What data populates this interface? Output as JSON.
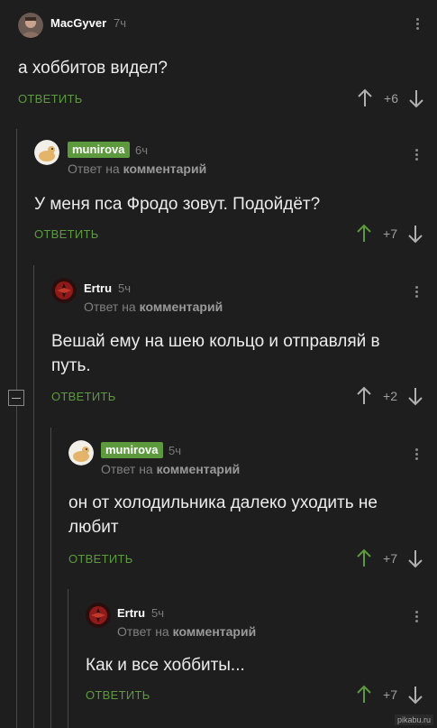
{
  "comments": [
    {
      "author": "MacGyver",
      "time": "7ч",
      "reply_to_prefix": "",
      "reply_to_target": "",
      "text": "а хоббитов видел?",
      "reply_label": "ОТВЕТИТЬ",
      "rating": "+6",
      "avatar_icon": "man-portrait-avatar"
    },
    {
      "author": "munirova",
      "time": "6ч",
      "reply_to_prefix": "Ответ на",
      "reply_to_target": "комментарий",
      "text": "У меня пса Фродо зовут. Подойдёт?",
      "reply_label": "ОТВЕТИТЬ",
      "rating": "+7",
      "avatar_icon": "dog-avatar"
    },
    {
      "author": "Ertru",
      "time": "5ч",
      "reply_to_prefix": "Ответ на",
      "reply_to_target": "комментарий",
      "text": "Вешай ему на шею кольцо и отправляй в путь.",
      "reply_label": "ОТВЕТИТЬ",
      "rating": "+2",
      "avatar_icon": "red-emblem-avatar"
    },
    {
      "author": "munirova",
      "time": "5ч",
      "reply_to_prefix": "Ответ на",
      "reply_to_target": "комментарий",
      "text": "он от холодильника далеко уходить не любит",
      "reply_label": "ОТВЕТИТЬ",
      "rating": "+7",
      "avatar_icon": "dog-avatar"
    },
    {
      "author": "Ertru",
      "time": "5ч",
      "reply_to_prefix": "Ответ на",
      "reply_to_target": "комментарий",
      "text": "Как и все хоббиты...",
      "reply_label": "ОТВЕТИТЬ",
      "rating": "+7",
      "avatar_icon": "red-emblem-avatar"
    }
  ],
  "watermark": "pikabu.ru",
  "colors": {
    "accent": "#5d9a3e",
    "background": "#1e1e1e",
    "upvoted": "#5d9a3e"
  }
}
